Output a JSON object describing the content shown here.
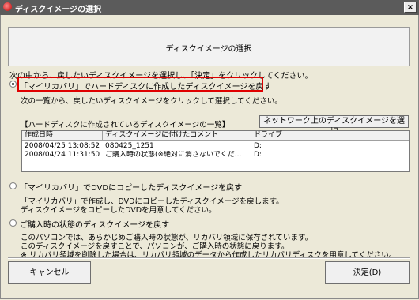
{
  "window": {
    "title": "ディスクイメージの選択",
    "close_label": "×"
  },
  "header": {
    "title": "ディスクイメージの選択"
  },
  "instruction": "次の中から、戻したいディスクイメージを選択し、「決定」をクリックしてください。",
  "option1": {
    "label": "「マイリカバリ」でハードディスクに作成したディスクイメージを戻す",
    "sub": "次の一覧から、戻したいディスクイメージをクリックして選択してください。",
    "checked": true
  },
  "list_section": {
    "caption": "【ハードディスクに作成されているディスクイメージの一覧】",
    "network_button": "ネットワーク上のディスクイメージを選択",
    "columns": [
      "作成日時",
      "ディスクイメージに付けたコメント",
      "ドライブ"
    ],
    "rows": [
      [
        "2008/04/25 13:08:52",
        "080425_1251",
        "D:"
      ],
      [
        "2008/04/24 11:31:50",
        "ご購入時の状態(※絶対に消さないでくだ...",
        "D:"
      ]
    ]
  },
  "option2": {
    "label": "「マイリカバリ」でDVDにコピーしたディスクイメージを戻す",
    "desc1": "「マイリカバリ」で作成し、DVDにコピーしたディスクイメージを戻します。",
    "desc2": "ディスクイメージをコピーしたDVDを用意してください。",
    "checked": false
  },
  "option3": {
    "label": "ご購入時の状態のディスクイメージを戻す",
    "desc1": "このパソコンでは、あらかじめご購入時の状態が、リカバリ領域に保存されています。",
    "desc2": "このディスクイメージを戻すことで、パソコンが、ご購入時の状態に戻ります。",
    "desc3": "※ リカバリ領域を削除した場合は、リカバリ領域のデータから作成したリカバリディスクを用意してください。",
    "checked": false
  },
  "buttons": {
    "cancel": "キャンセル",
    "ok": "決定(D)"
  },
  "colors": {
    "highlight": "#e00000",
    "titlebar": "#5b5b5b",
    "face": "#ece9d8"
  }
}
